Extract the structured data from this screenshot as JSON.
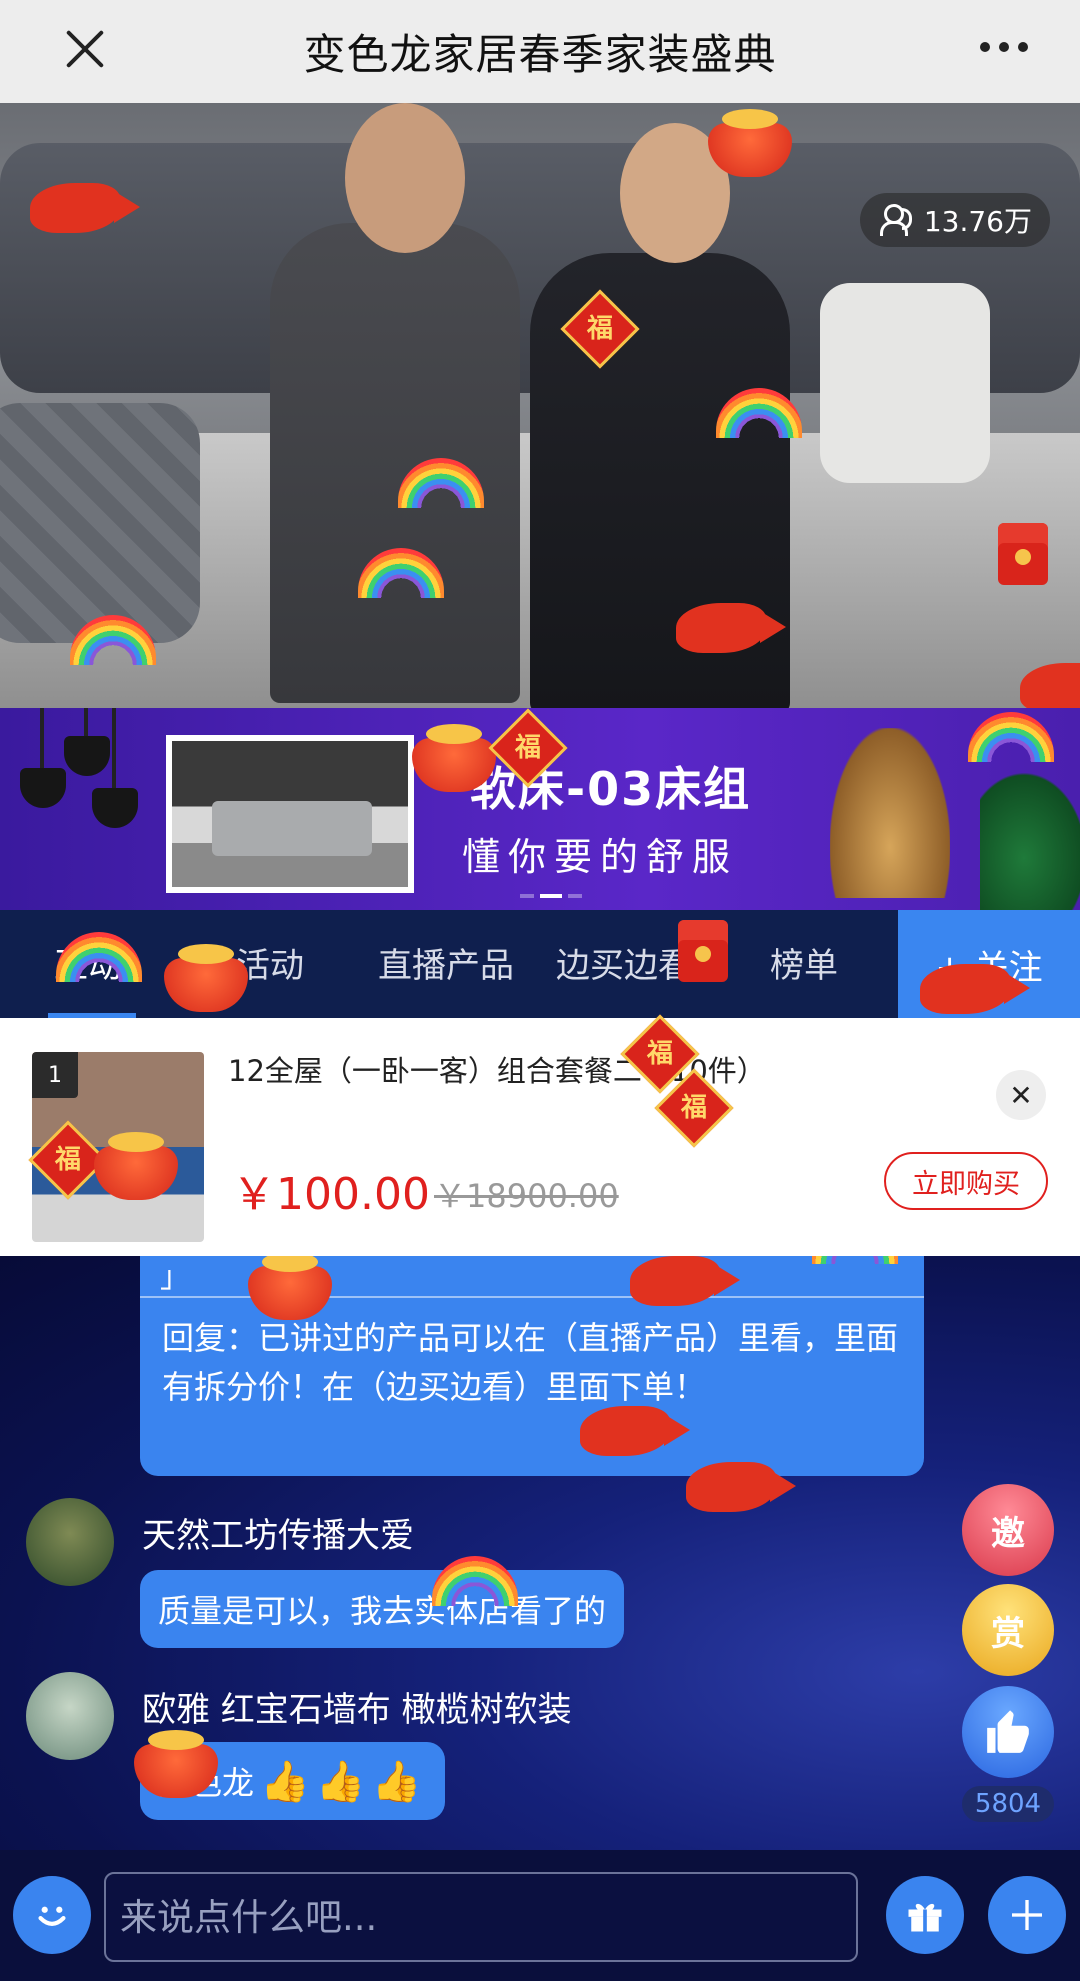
{
  "titlebar": {
    "title": "变色龙家居春季家装盛典",
    "close_icon": "close-icon",
    "more_icon": "more-icon"
  },
  "video": {
    "viewer_count": "13.76万"
  },
  "banner": {
    "title": "软床-03床组",
    "subtitle": "懂你要的舒服"
  },
  "tabs": [
    {
      "label": "互动"
    },
    {
      "label": "活动"
    },
    {
      "label": "直播产品"
    },
    {
      "label": "边买边看"
    },
    {
      "label": "榜单"
    }
  ],
  "follow_label": "+ 关注",
  "product": {
    "index": "1",
    "name": "12全屋（一卧一客）组合套餐二（10件）",
    "price": "￥100.00",
    "original_price": "￥18900.00",
    "buy_label": "立即购买",
    "close_label": "✕"
  },
  "chat": {
    "reply_bracket": "」",
    "reply_text": "回复：已讲过的产品可以在（直播产品）里看，里面有拆分价！在（边买边看）里面下单！",
    "messages": [
      {
        "user": "天然工坊传播大爱",
        "text": "质量是可以，我去实体店看了的"
      },
      {
        "user": "欧雅 红宝石墙布 橄榄树软装",
        "text": "变色龙",
        "emoji": "👍👍👍"
      }
    ]
  },
  "side": {
    "invite_label": "邀",
    "reward_label": "赏",
    "like_count": "5804"
  },
  "bottombar": {
    "input_placeholder": "来说点什么吧..."
  },
  "colors": {
    "accent": "#3a84ef",
    "price": "#e0201e",
    "tab_bg": "#0f1f4e"
  }
}
